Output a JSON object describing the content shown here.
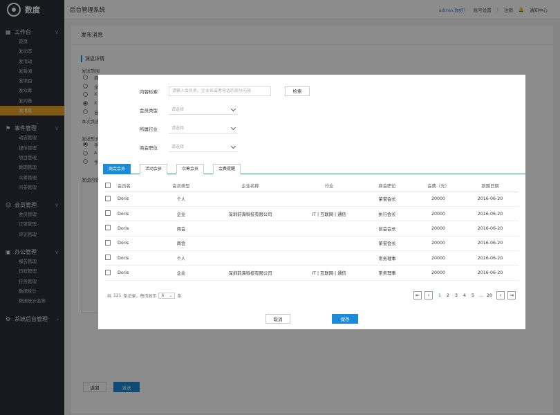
{
  "logo": {
    "text": "数度"
  },
  "header": {
    "title": "后台管理系统",
    "user": "admin,你好！",
    "account_settings": "账号设置",
    "sep": "|",
    "logout": "注销",
    "notify": "通知中心"
  },
  "sidebar": {
    "groups": [
      {
        "title": "工作台",
        "icon": "grid-icon",
        "items": [
          "首页",
          "发动态",
          "发活动",
          "发新闻",
          "发项目",
          "发众筹",
          "发问卷",
          "发消息"
        ],
        "active": 7
      },
      {
        "title": "事件管理",
        "icon": "flag-icon",
        "items": [
          "动态管理",
          "媒体管理",
          "项目管理",
          "教期管理",
          "众筹管理",
          "问卷管理"
        ]
      },
      {
        "title": "会员管理",
        "icon": "users-icon",
        "items": [
          "会员管理",
          "订单管理",
          "评论管理"
        ]
      },
      {
        "title": "办公管理",
        "icon": "office-icon",
        "items": [
          "报告管理",
          "日程管理",
          "任务管理",
          "数据统计",
          "数据统计名称"
        ]
      },
      {
        "title": "系统后台管理",
        "icon": "gear-icon",
        "items": []
      }
    ]
  },
  "page": {
    "title": "发布消息",
    "section": "消息详情",
    "scope_label": "发送范围",
    "scope_opts": [
      "商",
      "全",
      "X",
      "X",
      "自"
    ],
    "count_note": "本次共选",
    "method_label": "发送形式",
    "method_opts": [
      "手",
      "A",
      "手"
    ],
    "content_label": "发送内容",
    "back": "返回",
    "send": "发送"
  },
  "modal": {
    "search_label": "内容检索",
    "search_placeholder": "请输入会员名、企业名或者电话的部分内容",
    "search_button": "检索",
    "member_type_label": "会员类型",
    "industry_label": "所属行业",
    "position_label": "商会职位",
    "select_placeholder": "请选择",
    "tabs": [
      "商会会员",
      "活动会员",
      "众筹会员",
      "会费提醒"
    ],
    "columns": [
      "会员名",
      "会员类型",
      "企业名称",
      "行业",
      "商会职位",
      "会费（元）",
      "到期日期"
    ],
    "rows": [
      [
        "Doris",
        "个人",
        "",
        "",
        "荣誉会长",
        "20000",
        "2016-06-20"
      ],
      [
        "Doris",
        "企业",
        "深圳前海科技有限公司",
        "IT | 互联网 | 通信",
        "执行会长",
        "20000",
        "2016-06-20"
      ],
      [
        "Doris",
        "商会",
        "",
        "",
        "创会会长",
        "20000",
        "2016-06-20"
      ],
      [
        "Doris",
        "商会",
        "",
        "",
        "荣誉会长",
        "20000",
        "2016-06-20"
      ],
      [
        "Doris",
        "个人",
        "",
        "",
        "常务理事",
        "20000",
        "2016-06-20"
      ],
      [
        "Doris",
        "企业",
        "深圳前海科技有限公司",
        "IT | 互联网 | 通信",
        "常务理事",
        "20000",
        "2016-06-20"
      ]
    ],
    "pager": {
      "pre": "共",
      "total": "121",
      "mid": "条记录，每页显示",
      "per_page": "6",
      "post": "条",
      "pages": [
        "1",
        "2",
        "3",
        "4",
        "5",
        "...",
        "20"
      ],
      "current": "1"
    },
    "cancel": "取消",
    "save": "保存"
  },
  "colors": {
    "accent": "#1a8bd8",
    "active_nav": "#e8a11f",
    "sidebar": "#2b2f38"
  }
}
